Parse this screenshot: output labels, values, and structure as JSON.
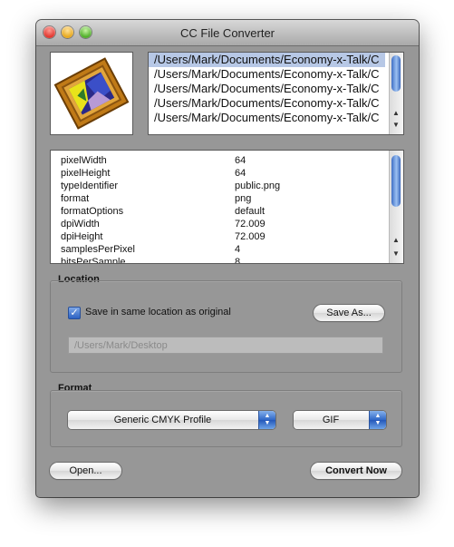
{
  "window": {
    "title": "CC File Converter"
  },
  "files": {
    "items": [
      "/Users/Mark/Documents/Economy-x-Talk/C",
      "/Users/Mark/Documents/Economy-x-Talk/C",
      "/Users/Mark/Documents/Economy-x-Talk/C",
      "/Users/Mark/Documents/Economy-x-Talk/C",
      "/Users/Mark/Documents/Economy-x-Talk/C"
    ],
    "selected_index": 0
  },
  "properties": [
    {
      "key": "pixelWidth",
      "value": "64"
    },
    {
      "key": "pixelHeight",
      "value": "64"
    },
    {
      "key": "typeIdentifier",
      "value": "public.png"
    },
    {
      "key": "format",
      "value": "png"
    },
    {
      "key": "formatOptions",
      "value": "default"
    },
    {
      "key": "dpiWidth",
      "value": "72.009"
    },
    {
      "key": "dpiHeight",
      "value": "72.009"
    },
    {
      "key": "samplesPerPixel",
      "value": "4"
    },
    {
      "key": "bitsPerSample",
      "value": "8"
    }
  ],
  "location": {
    "label": "Location",
    "checkbox_label": "Save in same location as original",
    "checked": true,
    "save_as_label": "Save As...",
    "path_placeholder": "/Users/Mark/Desktop"
  },
  "format": {
    "label": "Format",
    "profile_value": "Generic CMYK Profile",
    "type_value": "GIF"
  },
  "buttons": {
    "open_label": "Open...",
    "convert_label": "Convert Now"
  },
  "icons": {
    "close": "close-icon",
    "minimize": "minimize-icon",
    "zoom": "zoom-icon",
    "scroll_up": "arrow-up-icon",
    "scroll_down": "arrow-down-icon",
    "popup": "chevron-updown-icon"
  },
  "colors": {
    "window_bg": "#979797",
    "selection": "#b7c8e6",
    "accent_blue": "#2f67c7"
  }
}
